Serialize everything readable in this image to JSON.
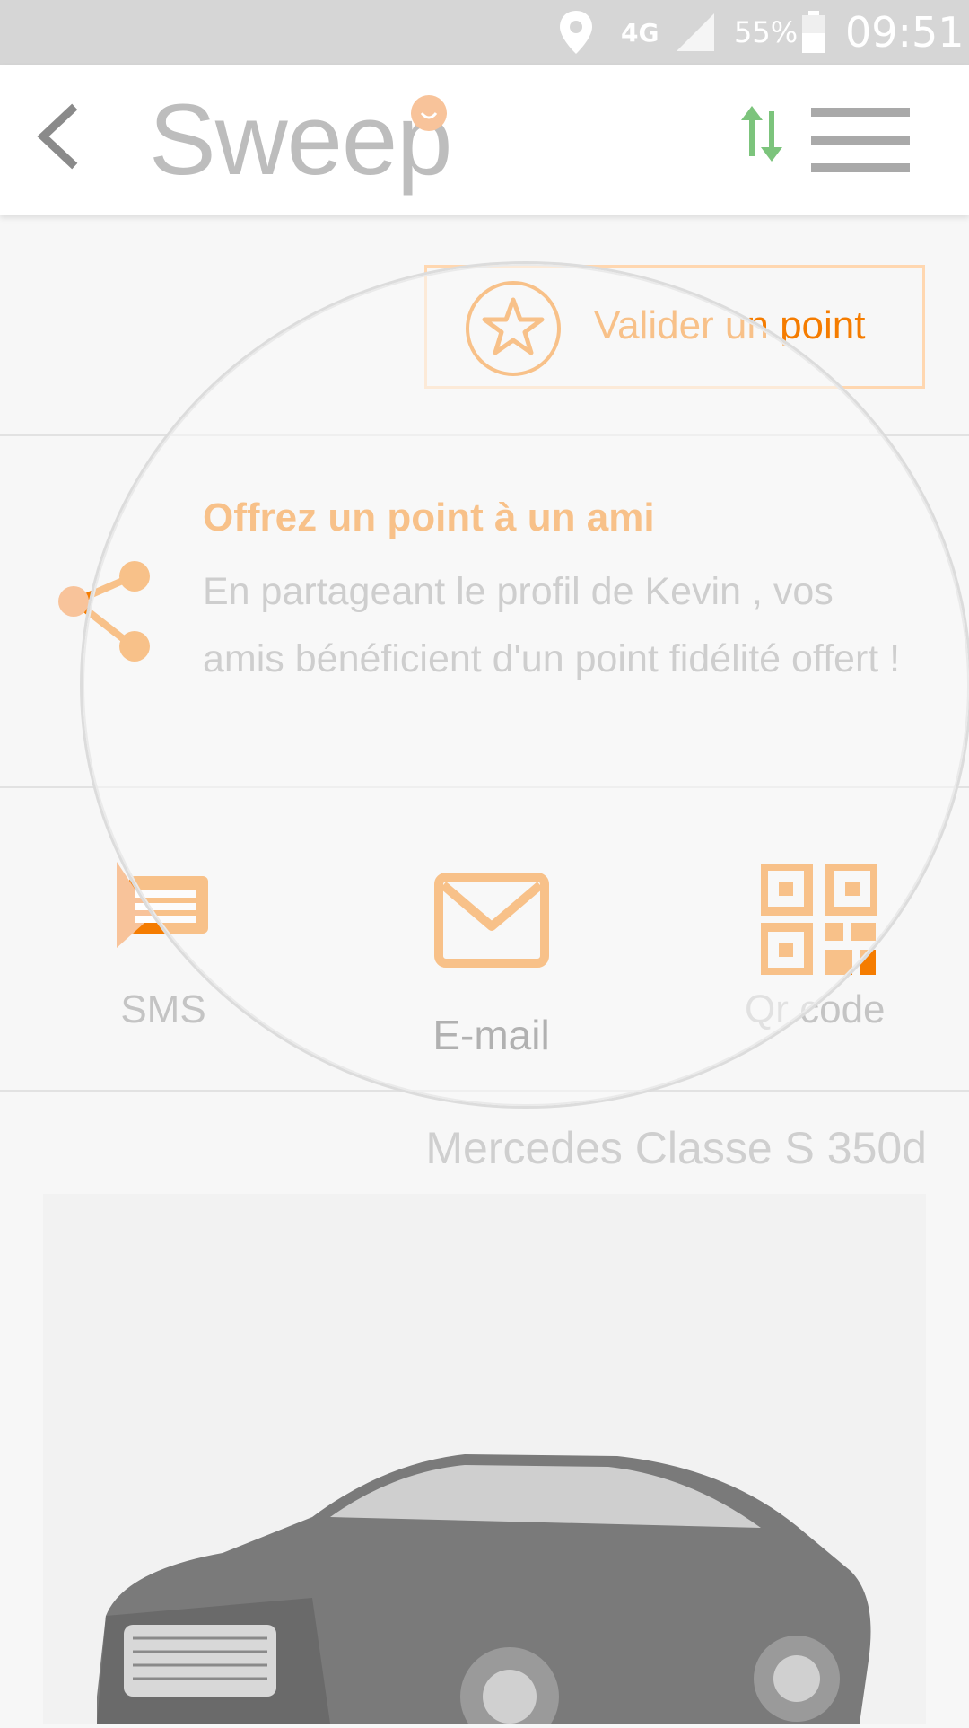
{
  "status_bar": {
    "network": "4G",
    "battery": "55%",
    "time": "09:51"
  },
  "app_bar": {
    "logo_text": "Sweep",
    "back_icon": "back-arrow-icon",
    "sync_icon": "sync-arrows-icon",
    "menu_icon": "hamburger-menu-icon"
  },
  "actions": {
    "validate_label": "Valider un point"
  },
  "offer": {
    "title": "Offrez un point à un ami",
    "description": "En partageant le profil de Kevin , vos amis bénéficient d'un point fidélité offert !"
  },
  "share_options": {
    "sms": "SMS",
    "email": "E-mail",
    "qr_code": "Qr code"
  },
  "product": {
    "title": "Mercedes Classe S 350d"
  },
  "colors": {
    "accent": "#f57c00",
    "accent_light": "#f8c39a",
    "text_gray": "#9a9a9a"
  }
}
